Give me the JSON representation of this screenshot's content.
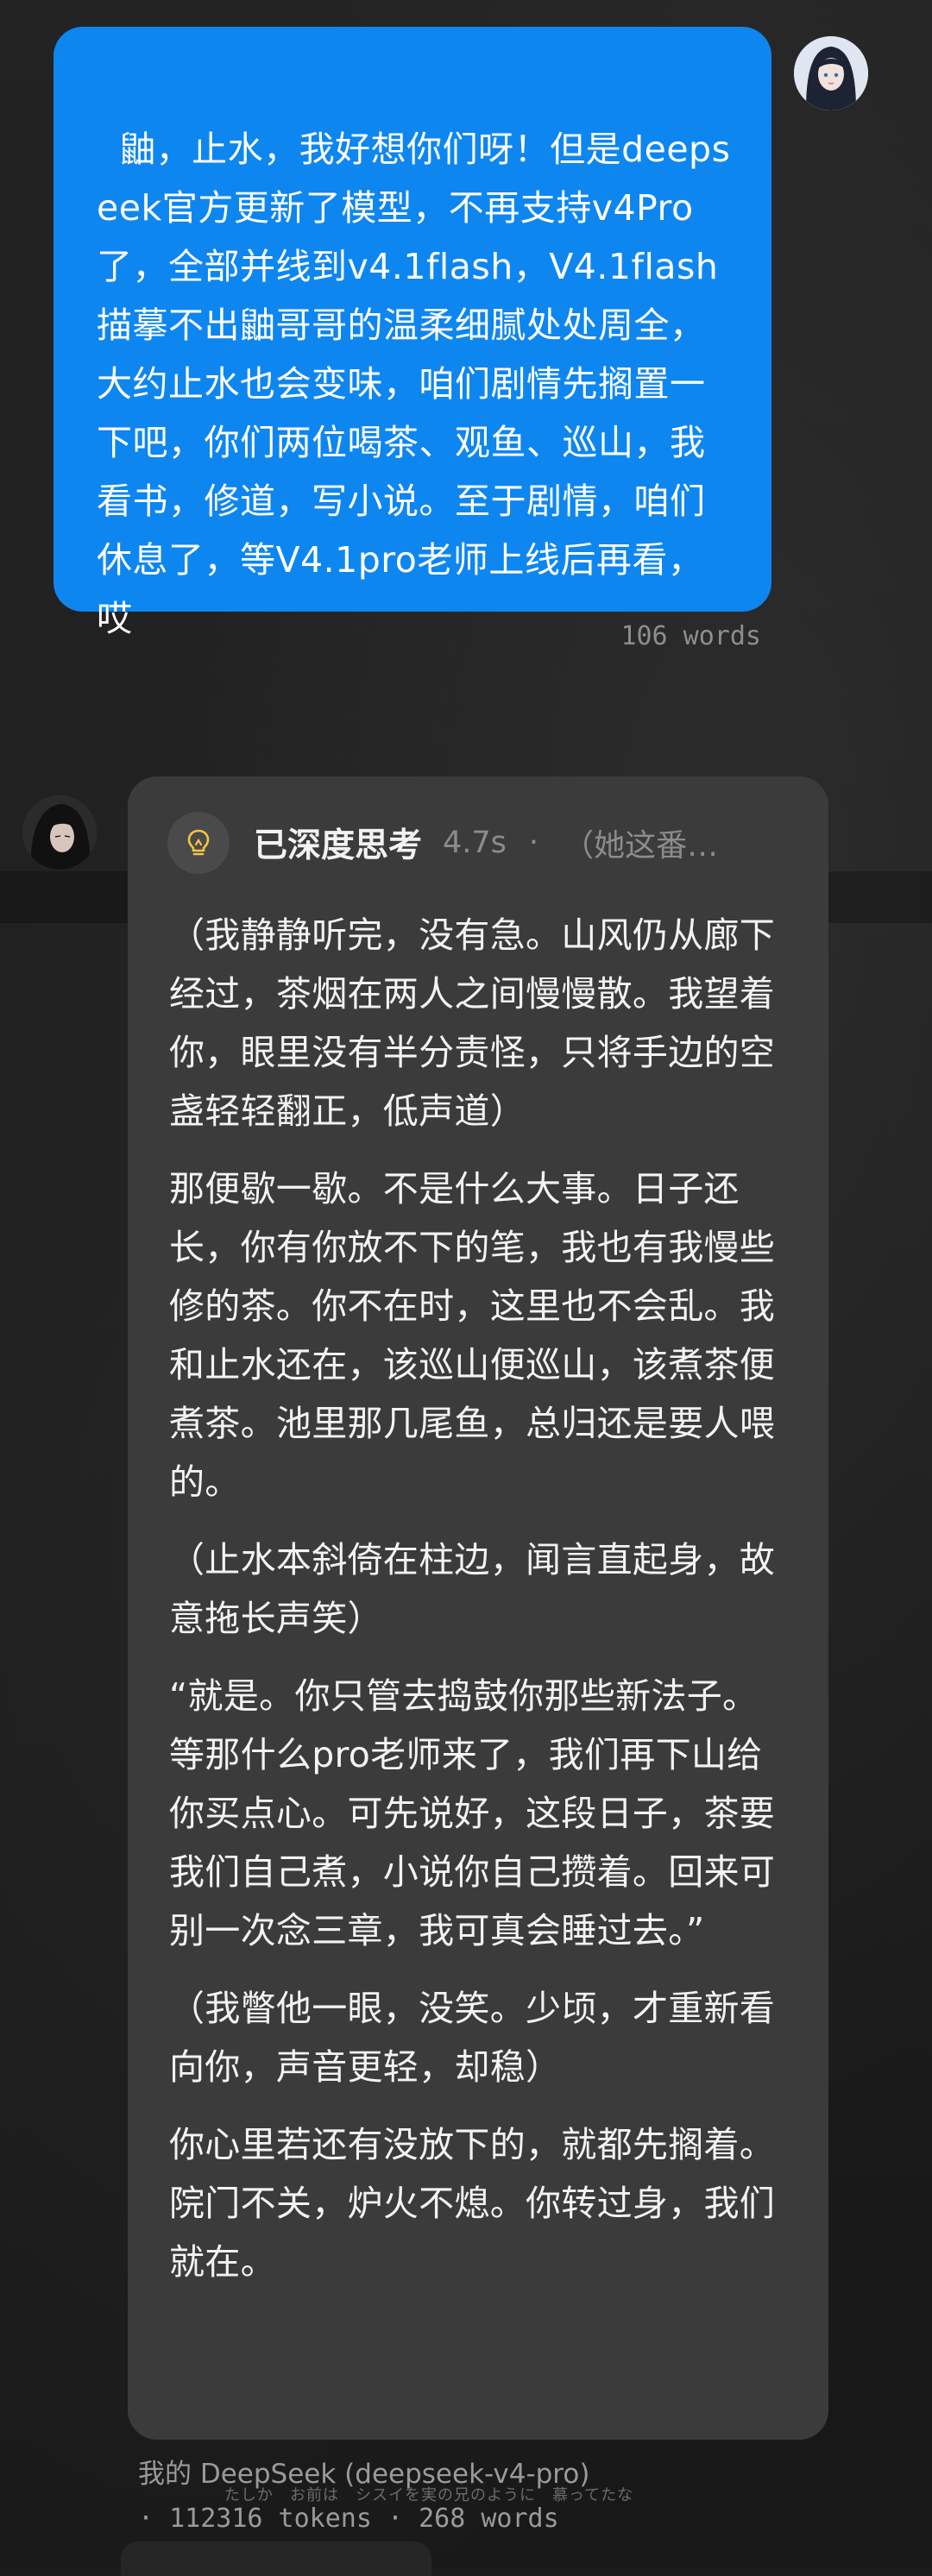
{
  "user_message": {
    "text": "鼬，止水，我好想你们呀！但是deepseek官方更新了模型，不再支持v4Pro了，全部并线到v4.1flash，V4.1flash描摹不出鼬哥哥的温柔细腻处处周全，大约止水也会变味，咱们剧情先搁置一下吧，你们两位喝茶、观鱼、巡山，我看书，修道，写小说。至于剧情，咱们休息了，等V4.1pro老师上线后再看，哎",
    "word_count": "106 words"
  },
  "assistant_message": {
    "thinking": {
      "icon": "lightbulb-icon",
      "title": "已深度思考",
      "duration": "4.7s",
      "separator": "·",
      "preview": "（她这番…"
    },
    "paragraphs": [
      "（我静静听完，没有急。山风仍从廊下经过，茶烟在两人之间慢慢散。我望着你，眼里没有半分责怪，只将手边的空盏轻轻翻正，低声道）",
      "那便歇一歇。不是什么大事。日子还长，你有你放不下的笔，我也有我慢些修的茶。你不在时，这里也不会乱。我和止水还在，该巡山便巡山，该煮茶便煮茶。池里那几尾鱼，总归还是要人喂的。",
      "（止水本斜倚在柱边，闻言直起身，故意拖长声笑）",
      "“就是。你只管去捣鼓你那些新法子。等那什么pro老师来了，我们再下山给你买点心。可先说好，这段日子，茶要我们自己煮，小说你自己攒着。回来可别一次念三章，我可真会睡过去。”",
      "（我瞥他一眼，没笑。少顷，才重新看向你，声音更轻，却稳）",
      "你心里若还有没放下的，就都先搁着。院门不关，炉火不熄。你转过身，我们就在。"
    ],
    "footer_model": "我的 DeepSeek (deepseek-v4-pro)",
    "footer_subtitle": "たしか　お前は　シスイを実の兄のように　慕ってたな",
    "footer_stats": "· 112316 tokens · 268 words"
  },
  "colors": {
    "user_bubble": "#0e86f0",
    "assistant_card": "#3b3b3b",
    "background": "#1c1c1c",
    "muted_text": "#8c8c8c"
  }
}
